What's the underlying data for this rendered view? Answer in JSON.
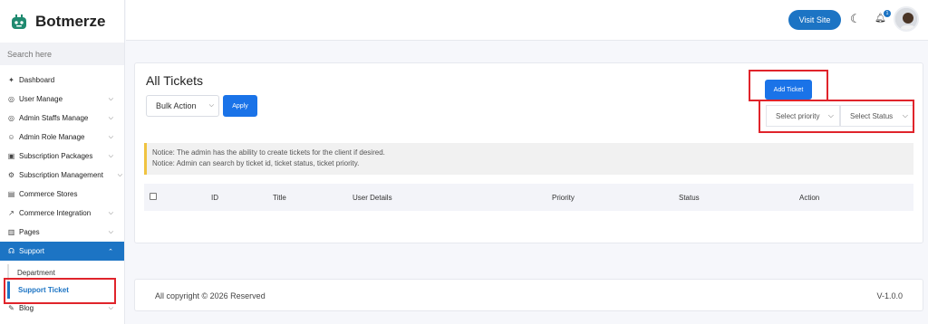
{
  "app": {
    "name": "Botmerze"
  },
  "search": {
    "placeholder": "Search here"
  },
  "sidebar": {
    "items": [
      {
        "label": "Dashboard",
        "icon": "dashboard-icon"
      },
      {
        "label": "User Manage",
        "icon": "user-icon"
      },
      {
        "label": "Admin Staffs Manage",
        "icon": "staff-icon"
      },
      {
        "label": "Admin Role Manage",
        "icon": "role-icon"
      },
      {
        "label": "Subscription Packages",
        "icon": "package-icon"
      },
      {
        "label": "Subscription Management",
        "icon": "subscription-icon"
      },
      {
        "label": "Commerce Stores",
        "icon": "store-icon"
      },
      {
        "label": "Commerce Integration",
        "icon": "integration-icon"
      },
      {
        "label": "Pages",
        "icon": "pages-icon"
      },
      {
        "label": "Support",
        "icon": "support-icon"
      },
      {
        "label": "Blog",
        "icon": "blog-icon"
      }
    ],
    "support_sub": [
      "Department",
      "Support Ticket"
    ]
  },
  "topbar": {
    "visit_site": "Visit Site",
    "notification_count": "1"
  },
  "main": {
    "title": "All Tickets",
    "bulk_action": "Bulk Action",
    "apply": "Apply",
    "add_ticket": "Add Ticket",
    "select_priority": "Select priority",
    "select_status": "Select Status",
    "notices": [
      "Notice: The admin has the ability to create tickets for the client if desired.",
      "Notice: Admin can search by ticket id, ticket status, ticket priority."
    ],
    "columns": [
      "ID",
      "Title",
      "User Details",
      "Priority",
      "Status",
      "Action"
    ]
  },
  "footer": {
    "copyright": "All copyright © 2026 Reserved",
    "version": "V-1.0.0"
  },
  "colors": {
    "accent": "#1c74c4",
    "button": "#1a73e8",
    "highlight": "#e0242b",
    "notice_border": "#f0c341"
  }
}
